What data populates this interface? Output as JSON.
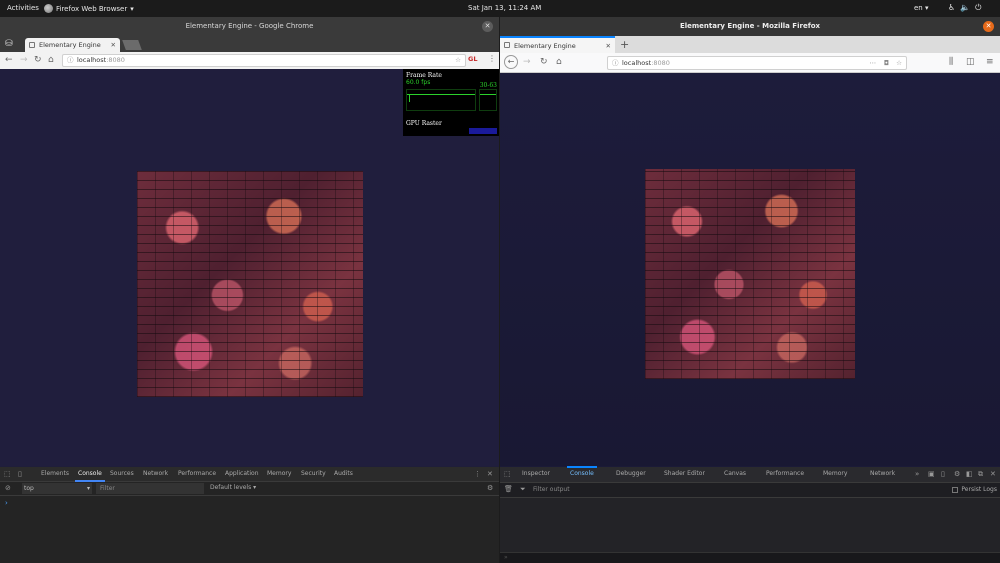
{
  "topbar": {
    "activities": "Activities",
    "app_name": "Firefox Web Browser",
    "app_menu_arrow": "▾",
    "clock": "Sat Jan 13, 11:24 AM",
    "language": "en ▾",
    "tray_icons": [
      "accessibility-icon",
      "volume-icon",
      "power-icon"
    ]
  },
  "chrome": {
    "window_title": "Elementary Engine - Google Chrome",
    "tab_title": "Elementary Engine",
    "url_host": "localhost",
    "url_port": ":8080",
    "extension_label": "GL",
    "fps_meter": {
      "title": "Frame Rate",
      "value": "60.0 fps",
      "range": "30-63",
      "gpu_label": "GPU Raster"
    },
    "devtools": {
      "tabs": [
        "Elements",
        "Console",
        "Sources",
        "Network",
        "Performance",
        "Application",
        "Memory",
        "Security",
        "Audits"
      ],
      "active_tab": "Console",
      "context": "top",
      "filter_placeholder": "Filter",
      "levels": "Default levels ▾",
      "prompt": "›"
    }
  },
  "firefox": {
    "window_title": "Elementary Engine - Mozilla Firefox",
    "tab_title": "Elementary Engine",
    "url_host": "localhost",
    "url_port": ":8080",
    "devtools": {
      "tabs": [
        "Inspector",
        "Console",
        "Debugger",
        "Shader Editor",
        "Canvas",
        "Performance",
        "Memory",
        "Network"
      ],
      "active_tab": "Console",
      "filter_placeholder": "Filter output",
      "persist_logs": "Persist Logs",
      "prompt": "»"
    }
  },
  "colors": {
    "viewport_bg": "#201e3d",
    "fps_green": "#2bd12b",
    "firefox_close": "#e66a1a",
    "chrome_active_tab_underline": "#4285f4",
    "firefox_accent": "#0a84ff"
  }
}
